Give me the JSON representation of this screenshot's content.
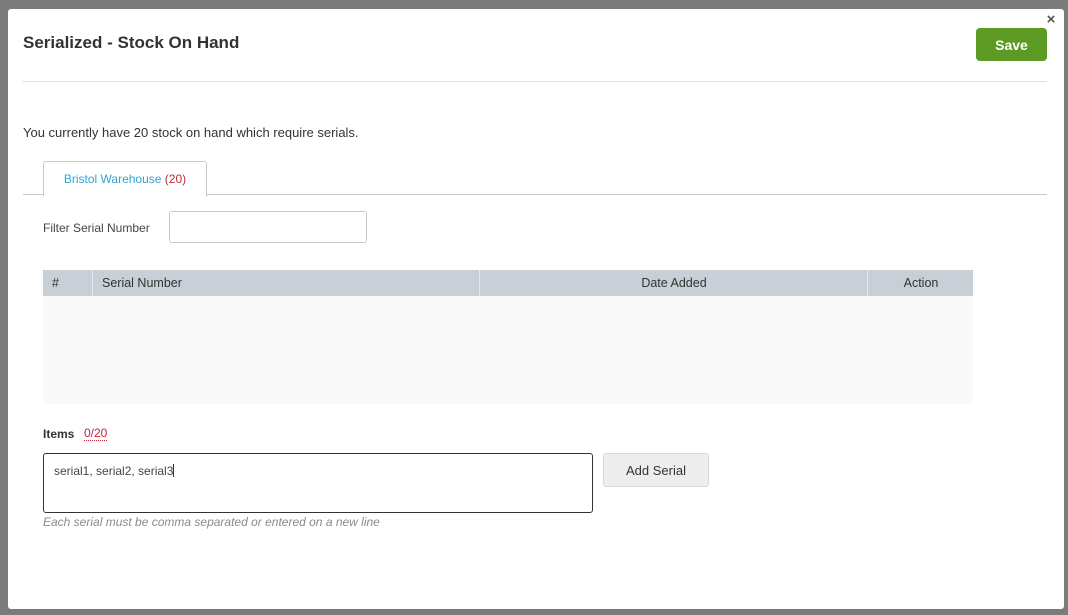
{
  "modal": {
    "title": "Serialized - Stock On Hand",
    "close_glyph": "×",
    "save_label": "Save",
    "info_text": "You currently have 20 stock on hand which require serials."
  },
  "tabs": [
    {
      "label": "Bristol Warehouse",
      "count": "(20)",
      "active": true
    }
  ],
  "filter": {
    "label": "Filter Serial Number",
    "value": ""
  },
  "table": {
    "columns": [
      "#",
      "Serial Number",
      "Date Added",
      "Action"
    ],
    "rows": []
  },
  "items": {
    "label": "Items",
    "count": "0/20",
    "input_value": "serial1, serial2, serial3",
    "add_label": "Add Serial",
    "hint": "Each serial must be comma separated or entered on a new line"
  },
  "colors": {
    "save_button": "#5c9a23",
    "tab_link": "#2fa4d6",
    "count_red": "#c0263b",
    "table_header": "#c8cfd6"
  }
}
